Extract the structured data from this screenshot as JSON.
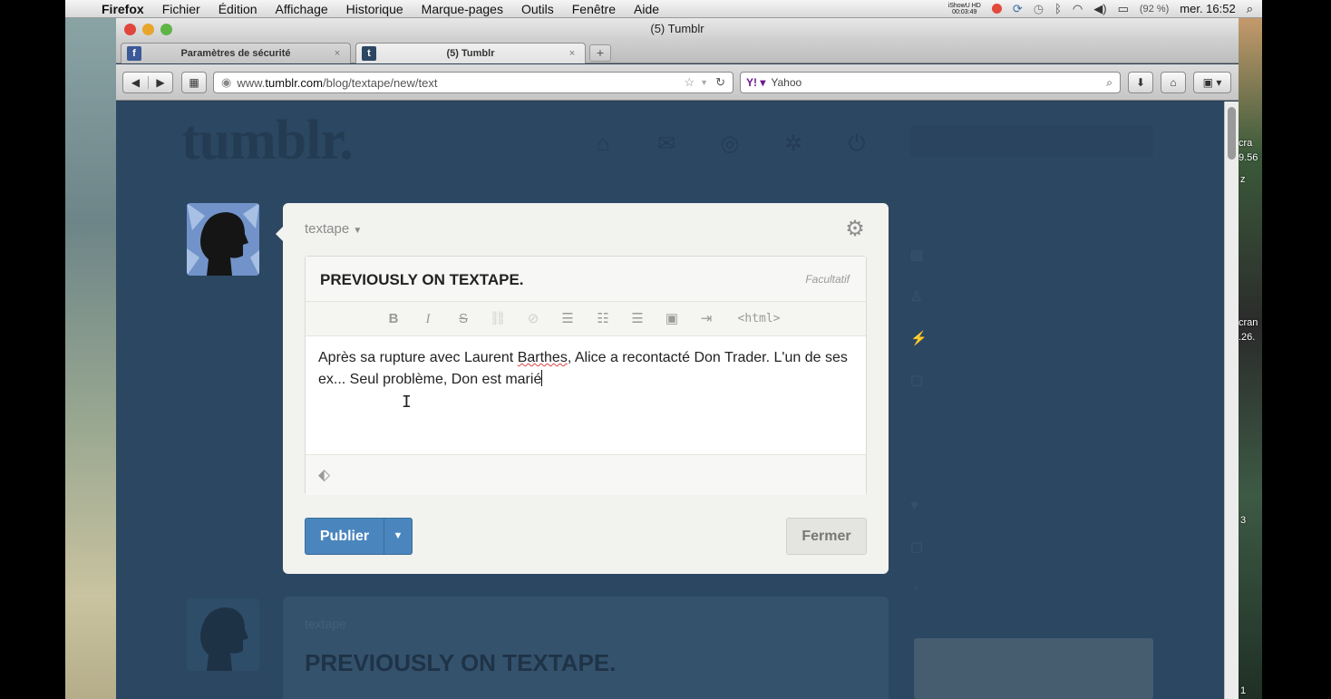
{
  "menubar": {
    "app": "Firefox",
    "items": [
      "Fichier",
      "Édition",
      "Affichage",
      "Historique",
      "Marque-pages",
      "Outils",
      "Fenêtre",
      "Aide"
    ],
    "status": {
      "recorder_line1": "iShowU HD",
      "recorder_line2": "00:03:49",
      "battery": "(92 %)",
      "clock": "mer. 16:52"
    }
  },
  "window": {
    "title": "(5) Tumblr"
  },
  "tabs": [
    {
      "label": "Paramètres de sécurité",
      "favicon": "f",
      "favicon_color": "#3b5998",
      "active": false
    },
    {
      "label": "(5) Tumblr",
      "favicon": "t",
      "favicon_color": "#2c4762",
      "active": true
    }
  ],
  "navbar": {
    "url_prefix": "www.",
    "url_host": "tumblr.com",
    "url_path": "/blog/textape/new/text",
    "search_engine": "Yahoo"
  },
  "editor": {
    "blog_name": "textape",
    "title": "PREVIOUSLY ON TEXTAPE.",
    "title_optional": "Facultatif",
    "toolbar": {
      "bold": "B",
      "italic": "I",
      "strike": "S",
      "html": "<html>"
    },
    "body_part1": "Après sa rupture avec Laurent ",
    "body_spell": "Barthes",
    "body_part2": ", Alice a recontacté Don Trader. L'un de ses ex... Seul problème, Don est marié",
    "publish_label": "Publier",
    "close_label": "Fermer"
  },
  "background_post": {
    "blog_name": "textape",
    "title": "PREVIOUSLY ON TEXTAPE."
  },
  "desktop_labels": [
    "cra",
    "9.56",
    "z",
    "cran",
    ".26.",
    "3",
    "1"
  ],
  "colors": {
    "tumblr_bg": "#2c4762",
    "publish_blue": "#4a86bd",
    "editor_bg": "#f2f2ef"
  }
}
